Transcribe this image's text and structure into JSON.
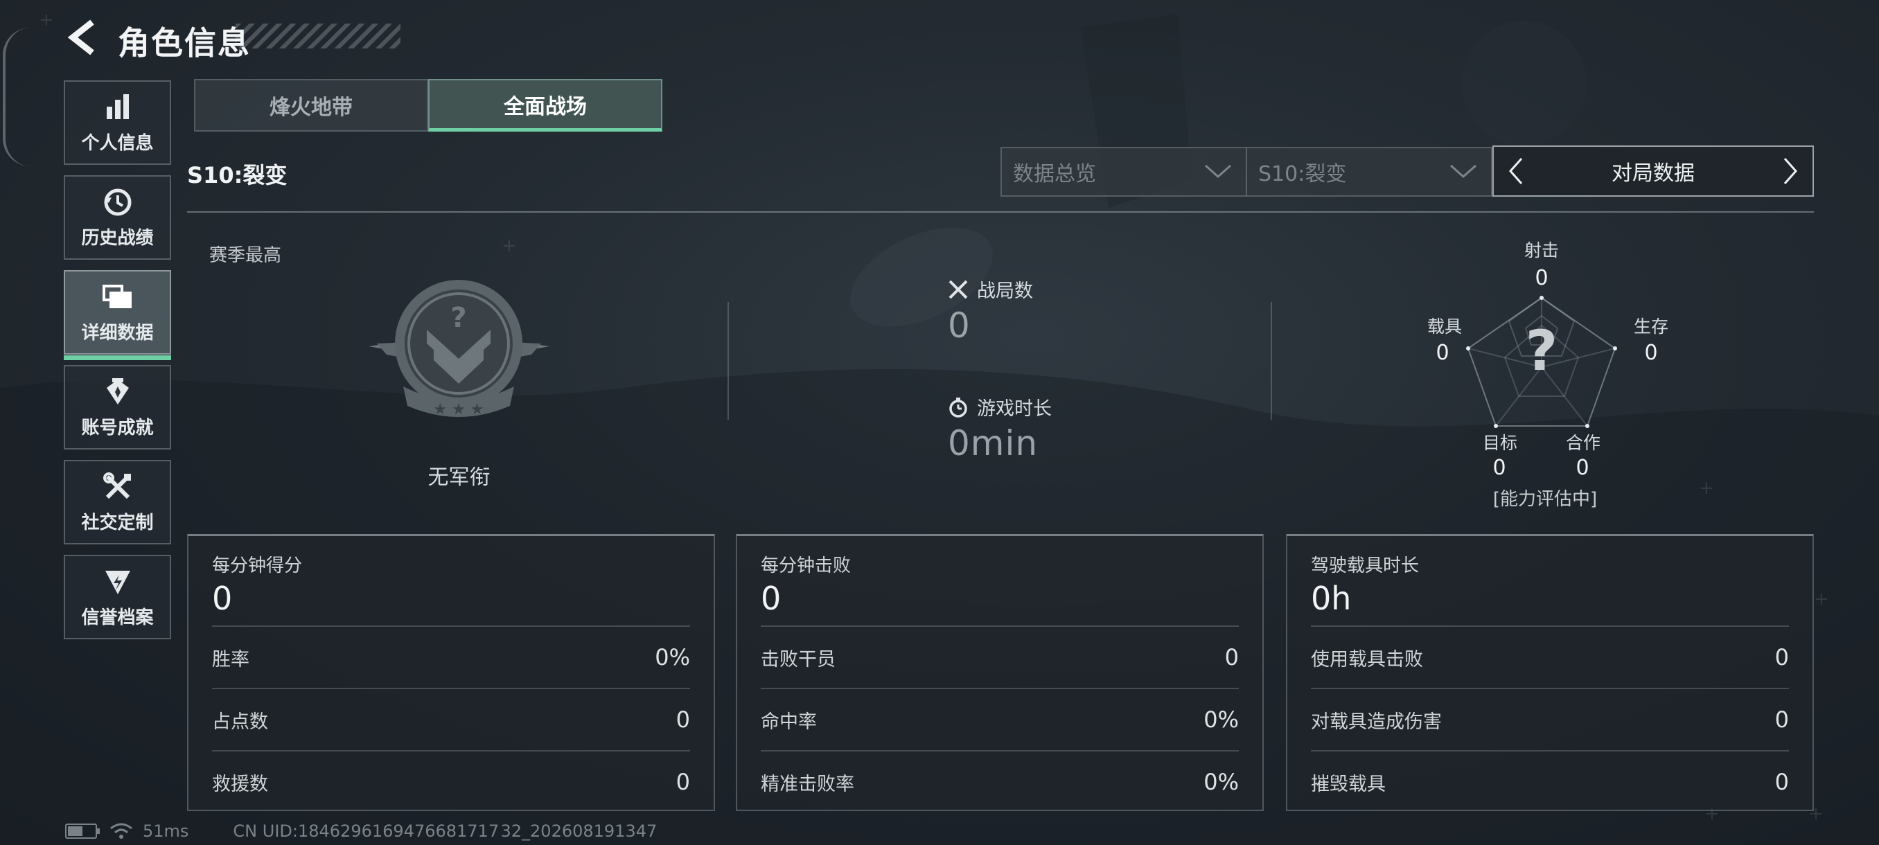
{
  "header": {
    "title": "角色信息",
    "back_icon": "back-arrow-icon"
  },
  "sidebar": {
    "items": [
      {
        "label": "个人信息",
        "icon": "bar-chart-icon",
        "active": false
      },
      {
        "label": "历史战绩",
        "icon": "history-icon",
        "active": false
      },
      {
        "label": "详细数据",
        "icon": "cards-icon",
        "active": true
      },
      {
        "label": "账号成就",
        "icon": "achievement-icon",
        "active": false
      },
      {
        "label": "社交定制",
        "icon": "tools-icon",
        "active": false
      },
      {
        "label": "信誉档案",
        "icon": "credit-shield-icon",
        "active": false
      }
    ]
  },
  "mode_tabs": [
    {
      "label": "烽火地带",
      "active": false
    },
    {
      "label": "全面战场",
      "active": true
    }
  ],
  "season_label": "S10:裂变",
  "filters": {
    "data_type": "数据总览",
    "season": "S10:裂变",
    "match_nav": "对局数据"
  },
  "season_best": {
    "title": "赛季最高",
    "rank_name": "无军衔"
  },
  "summary": {
    "matches_label": "战局数",
    "matches_value": "0",
    "playtime_label": "游戏时长",
    "playtime_value": "0min"
  },
  "radar": {
    "top": {
      "label": "射击",
      "value": "0"
    },
    "right": {
      "label": "生存",
      "value": "0"
    },
    "bottom_right": {
      "label": "合作",
      "value": "0"
    },
    "bottom_left": {
      "label": "目标",
      "value": "0"
    },
    "left": {
      "label": "载具",
      "value": "0"
    },
    "center_symbol": "?",
    "status": "[能力评估中]"
  },
  "cards": [
    {
      "title": "每分钟得分",
      "value": "0",
      "rows": [
        {
          "label": "胜率",
          "value": "0%"
        },
        {
          "label": "占点数",
          "value": "0"
        },
        {
          "label": "救援数",
          "value": "0"
        }
      ]
    },
    {
      "title": "每分钟击败",
      "value": "0",
      "rows": [
        {
          "label": "击败干员",
          "value": "0"
        },
        {
          "label": "命中率",
          "value": "0%"
        },
        {
          "label": "精准击败率",
          "value": "0%"
        }
      ]
    },
    {
      "title": "驾驶载具时长",
      "value": "0h",
      "rows": [
        {
          "label": "使用载具击败",
          "value": "0"
        },
        {
          "label": "对载具造成伤害",
          "value": "0"
        },
        {
          "label": "摧毁载具",
          "value": "0"
        }
      ]
    }
  ],
  "status_bar": {
    "battery_level": 0.55,
    "ping": "51ms",
    "uid": "CN UID:1846296169476681717 32_202608191347"
  },
  "colors": {
    "accent": "#6fd0a6",
    "background": "#232a31"
  }
}
